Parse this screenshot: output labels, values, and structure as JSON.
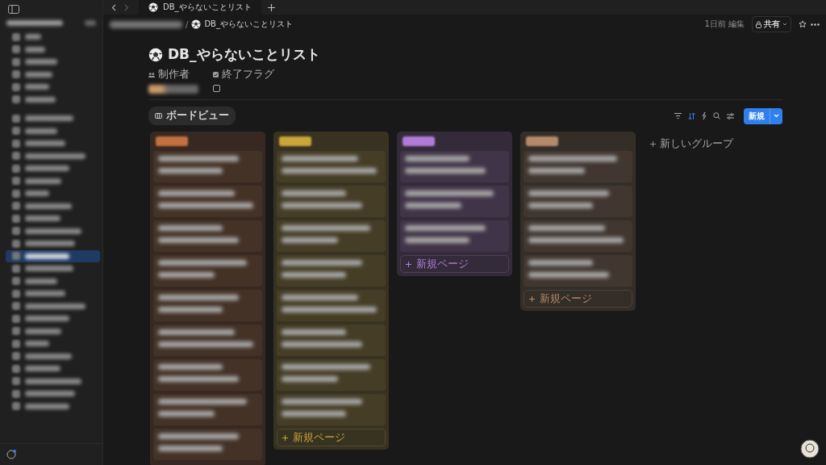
{
  "tab": {
    "title": "DB_やらないことリスト"
  },
  "breadcrumb": {
    "separator": "/",
    "page": "DB_やらないことリスト"
  },
  "topbar": {
    "edited": "1日前 編集",
    "share": "共有"
  },
  "sidebar": {
    "top_items": [
      {
        "selected": false
      },
      {
        "selected": false
      },
      {
        "selected": false
      },
      {
        "selected": false
      },
      {
        "selected": false
      },
      {
        "selected": false
      }
    ],
    "pages": [
      {
        "selected": false
      },
      {
        "selected": false
      },
      {
        "selected": false
      },
      {
        "selected": false
      },
      {
        "selected": false
      },
      {
        "selected": false
      },
      {
        "selected": false
      },
      {
        "selected": false
      },
      {
        "selected": false
      },
      {
        "selected": false
      },
      {
        "selected": false
      },
      {
        "selected": true
      },
      {
        "selected": false
      },
      {
        "selected": false
      },
      {
        "selected": false
      },
      {
        "selected": false
      },
      {
        "selected": false
      },
      {
        "selected": false
      },
      {
        "selected": false
      },
      {
        "selected": false
      },
      {
        "selected": false
      },
      {
        "selected": false
      },
      {
        "selected": false
      },
      {
        "selected": false
      }
    ]
  },
  "page": {
    "title": "DB_やらないことリスト",
    "properties": [
      {
        "kind": "person",
        "label": "制作者"
      },
      {
        "kind": "checkbox",
        "label": "終了フラグ",
        "checked": false
      }
    ]
  },
  "view": {
    "tab": "ボードビュー",
    "new_button": "新規",
    "new_group": "新しいグループ"
  },
  "columns": [
    {
      "color": "#c2703f",
      "cards": [
        {
          "kind": "two-line"
        },
        {
          "kind": "two-line"
        },
        {
          "kind": "two-line"
        },
        {
          "kind": "two-line"
        },
        {
          "kind": "two-line"
        },
        {
          "kind": "two-line"
        },
        {
          "kind": "two-line"
        },
        {
          "kind": "two-line"
        },
        {
          "kind": "two-line"
        }
      ]
    },
    {
      "color": "#c9a53a",
      "new_page": "新規ページ",
      "cards": [
        {
          "kind": "two-line"
        },
        {
          "kind": "two-line"
        },
        {
          "kind": "two-line"
        },
        {
          "kind": "two-line"
        },
        {
          "kind": "two-line"
        },
        {
          "kind": "two-line"
        },
        {
          "kind": "two-line"
        },
        {
          "kind": "two-line"
        }
      ]
    },
    {
      "color": "#b07cd8",
      "new_page": "新規ページ",
      "cards": [
        {
          "kind": "two-line"
        },
        {
          "kind": "two-line"
        },
        {
          "kind": "two-line"
        }
      ]
    },
    {
      "color": "#b58a6a",
      "new_page": "新規ページ",
      "cards": [
        {
          "kind": "two-line"
        },
        {
          "kind": "two-line"
        },
        {
          "kind": "two-line"
        },
        {
          "kind": "two-line"
        }
      ]
    }
  ]
}
